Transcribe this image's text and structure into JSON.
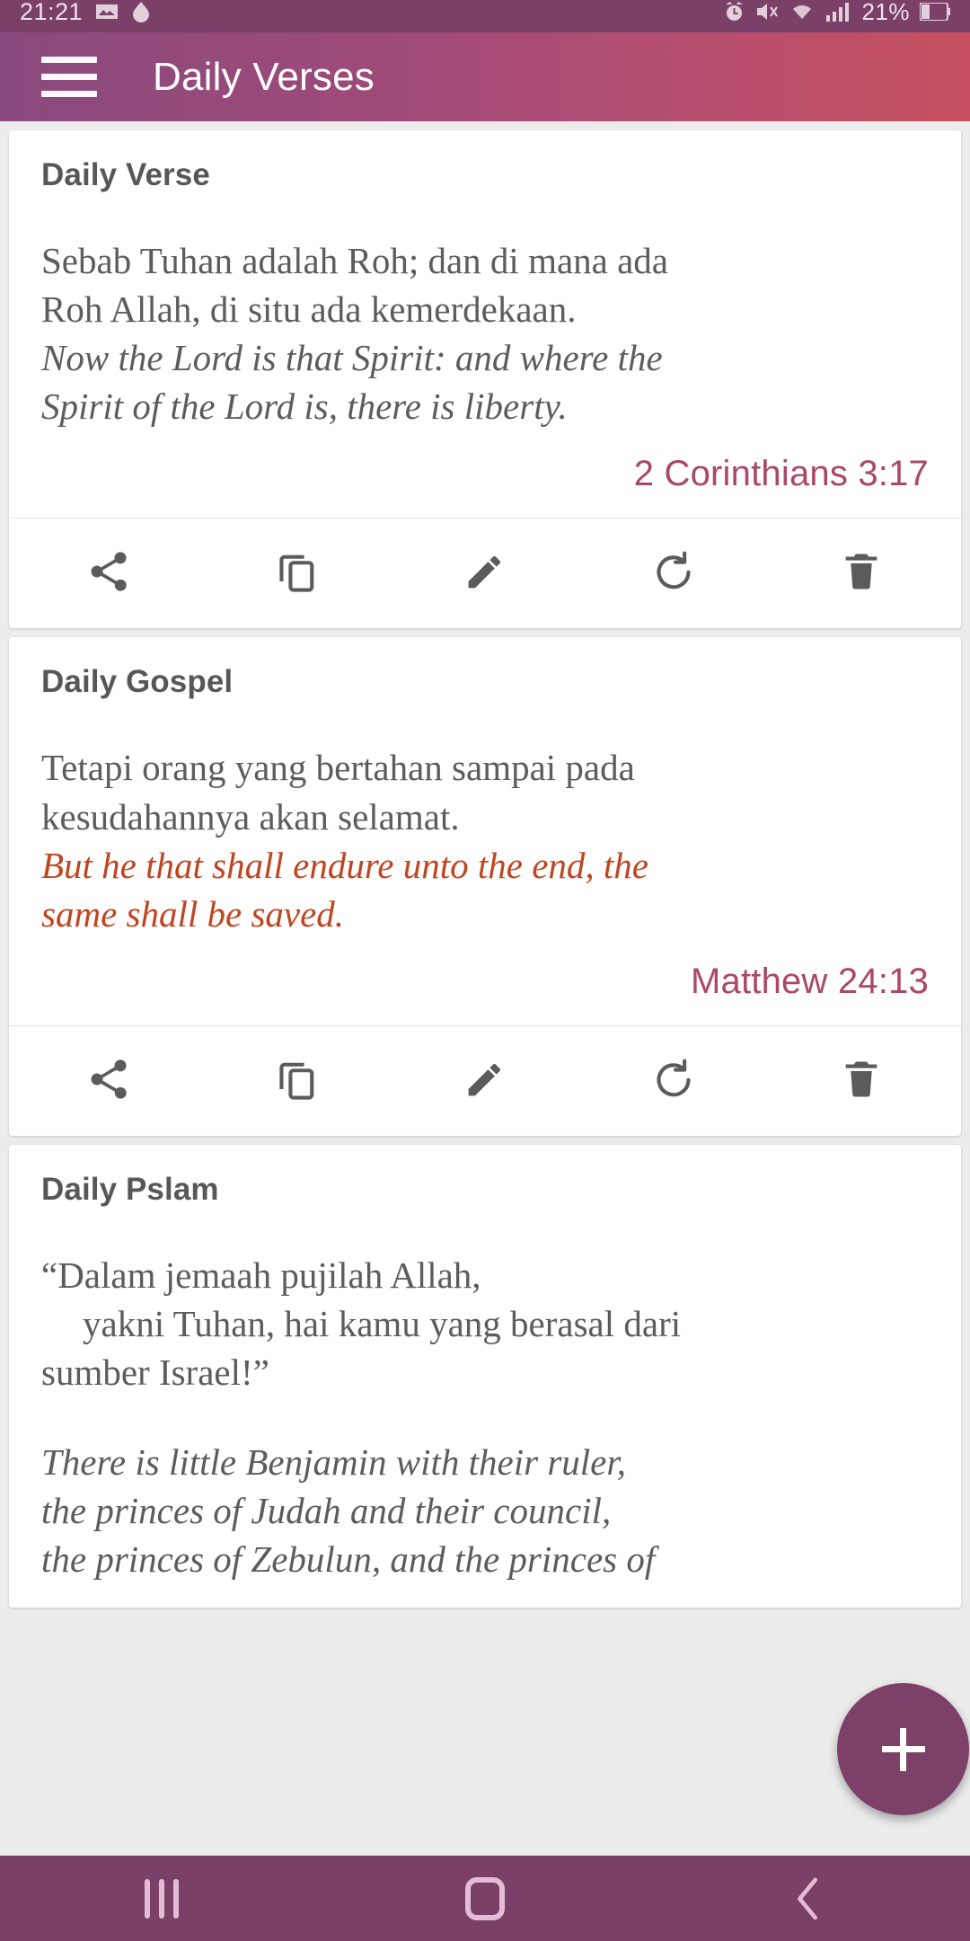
{
  "status_bar": {
    "clock": "21:21",
    "battery_percent": "21%",
    "left_icons": [
      "gallery-icon",
      "droplet-icon"
    ],
    "right_icons": [
      "alarm-icon",
      "mute-icon",
      "wifi-icon",
      "signal-icon",
      "battery-icon"
    ]
  },
  "app_bar": {
    "title": "Daily Verses",
    "menu_icon": "hamburger-menu-icon",
    "gradient_start": "#8a4a7d",
    "gradient_end": "#c6505f"
  },
  "theme": {
    "primary": "#7b4068",
    "accent_reference": "#ab4769",
    "gospel_red": "#c0451f",
    "body_text": "#5c5c5c",
    "fab_background": "#7d4069"
  },
  "actions": {
    "share_label": "Share",
    "copy_label": "Copy",
    "edit_label": "Edit",
    "refresh_label": "Refresh",
    "delete_label": "Delete"
  },
  "cards": [
    {
      "title": "Daily Verse",
      "native_lines": [
        "Sebab Tuhan adalah Roh; dan di mana ada",
        "Roh Allah, di situ ada kemerdekaan."
      ],
      "english_lines": [
        "Now the Lord is that Spirit: and where the",
        "Spirit of the Lord is, there is liberty."
      ],
      "english_color": "#5c5c5c",
      "reference": "2 Corinthians 3:17"
    },
    {
      "title": "Daily Gospel",
      "native_lines": [
        "Tetapi orang yang bertahan sampai pada",
        "kesudahannya akan selamat."
      ],
      "english_lines": [
        "But he that shall endure unto the end, the",
        "same shall be saved."
      ],
      "english_color": "#c0451f",
      "reference": "Matthew 24:13"
    },
    {
      "title": "Daily Pslam",
      "native_lines": [
        "“Dalam jemaah pujilah Allah,",
        "yakni Tuhan, hai kamu yang berasal dari",
        "sumber Israel!”"
      ],
      "english_lines": [
        "There is little Benjamin with their ruler,",
        "the princes of Judah and their council,",
        "the princes of Zebulun, and the princes of"
      ],
      "english_color": "#5c5c5c",
      "reference": ""
    }
  ],
  "fab": {
    "icon": "plus-icon",
    "label": "Add"
  },
  "nav_bar": {
    "recents_label": "Recents",
    "home_label": "Home",
    "back_label": "Back"
  }
}
